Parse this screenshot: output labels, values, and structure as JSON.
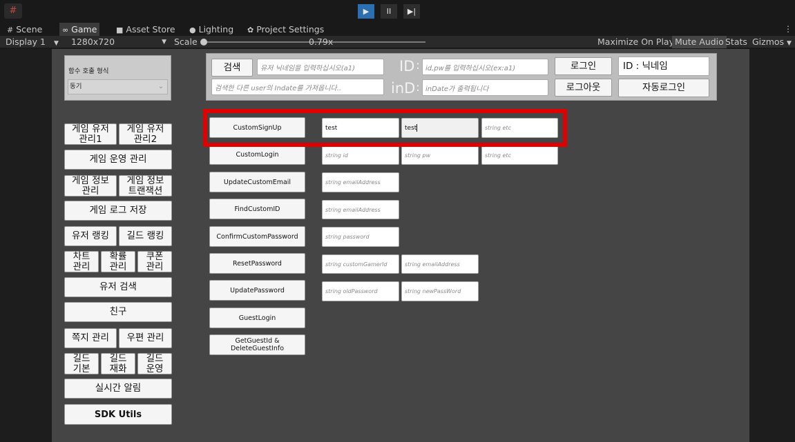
{
  "toolbar": {
    "menu_icon": "#",
    "play": "▶",
    "pause": "II",
    "step": "▶|"
  },
  "tabs": [
    {
      "icon": "#",
      "label": "Scene"
    },
    {
      "icon": "∞",
      "label": "Game"
    },
    {
      "icon": "■",
      "label": "Asset Store"
    },
    {
      "icon": "●",
      "label": "Lighting"
    },
    {
      "icon": "✿",
      "label": "Project Settings"
    }
  ],
  "kebab": "⋮",
  "game_toolbar": {
    "display": "Display 1",
    "resolution": "1280x720",
    "scale_label": "Scale",
    "scale_value": "0.79x",
    "maximize": "Maximize On Play",
    "mute": "Mute Audio",
    "stats": "Stats",
    "gizmos": "Gizmos",
    "dropdown": "▼"
  },
  "call_panel": {
    "label": "함수 호출 형식",
    "value": "동기",
    "arrow": "⌄"
  },
  "login_panel": {
    "search_button": "검색",
    "nickname_placeholder": "유저 닉네임을 입력하십시오(a1)",
    "indate_placeholder": "검색한 다른 user의 Indate를 가져옵니다..",
    "id_label": "ID",
    "colon": ":",
    "idpw_placeholder": "id,pw를 입력하십시오(ex:a1)",
    "ind_label": "inD",
    "indate_out_placeholder": "inDate가 출력됩니다",
    "login_button": "로그인",
    "logout_button": "로그아웃",
    "id_nick": "ID : 닉네임",
    "autologin_button": "자동로그인"
  },
  "menu": {
    "user_mgmt1": "게임 유저\n관리1",
    "user_mgmt2": "게임 유저\n관리2",
    "operation": "게임 운영 관리",
    "game_info": "게임 정보\n관리",
    "game_tx": "게임 정보\n트랜잭션",
    "log_save": "게임 로그 저장",
    "user_rank": "유저 랭킹",
    "guild_rank": "길드 랭킹",
    "chart": "차트\n관리",
    "prob": "확률\n관리",
    "coupon": "쿠폰\n관리",
    "user_search": "유저 검색",
    "friend": "친구",
    "note": "쪽지 관리",
    "post": "우편 관리",
    "guild_basic": "길드\n기본",
    "guild_goods": "길드\n재화",
    "guild_op": "길드\n운영",
    "realtime": "실시간 알림",
    "sdk": "SDK Utils"
  },
  "functions": [
    {
      "name": "CustomSignUp",
      "fields": [
        {
          "text": "test",
          "filled": true
        },
        {
          "text": "test",
          "filled": true
        },
        {
          "text": "string etc",
          "filled": false
        }
      ]
    },
    {
      "name": "CustomLogin",
      "fields": [
        {
          "text": "string id",
          "filled": false
        },
        {
          "text": "string pw",
          "filled": false
        },
        {
          "text": "string etc",
          "filled": false
        }
      ]
    },
    {
      "name": "UpdateCustomEmail",
      "fields": [
        {
          "text": "string emailAddress",
          "filled": false
        }
      ]
    },
    {
      "name": "FindCustomID",
      "fields": [
        {
          "text": "string emailAddress",
          "filled": false
        }
      ]
    },
    {
      "name": "ConfirmCustomPassword",
      "fields": [
        {
          "text": "string password",
          "filled": false
        }
      ]
    },
    {
      "name": "ResetPassword",
      "fields": [
        {
          "text": "string customGamerId",
          "filled": false
        },
        {
          "text": "string emailAddress",
          "filled": false
        }
      ]
    },
    {
      "name": "UpdatePassword",
      "fields": [
        {
          "text": "string oldPassword",
          "filled": false
        },
        {
          "text": "string newPassWord",
          "filled": false
        }
      ]
    },
    {
      "name": "GuestLogin",
      "fields": []
    },
    {
      "name": "GetGuestId & DeleteGuestInfo",
      "fields": []
    }
  ],
  "colors": {
    "highlight": "#e00000",
    "play_active": "#2c6fb0"
  }
}
